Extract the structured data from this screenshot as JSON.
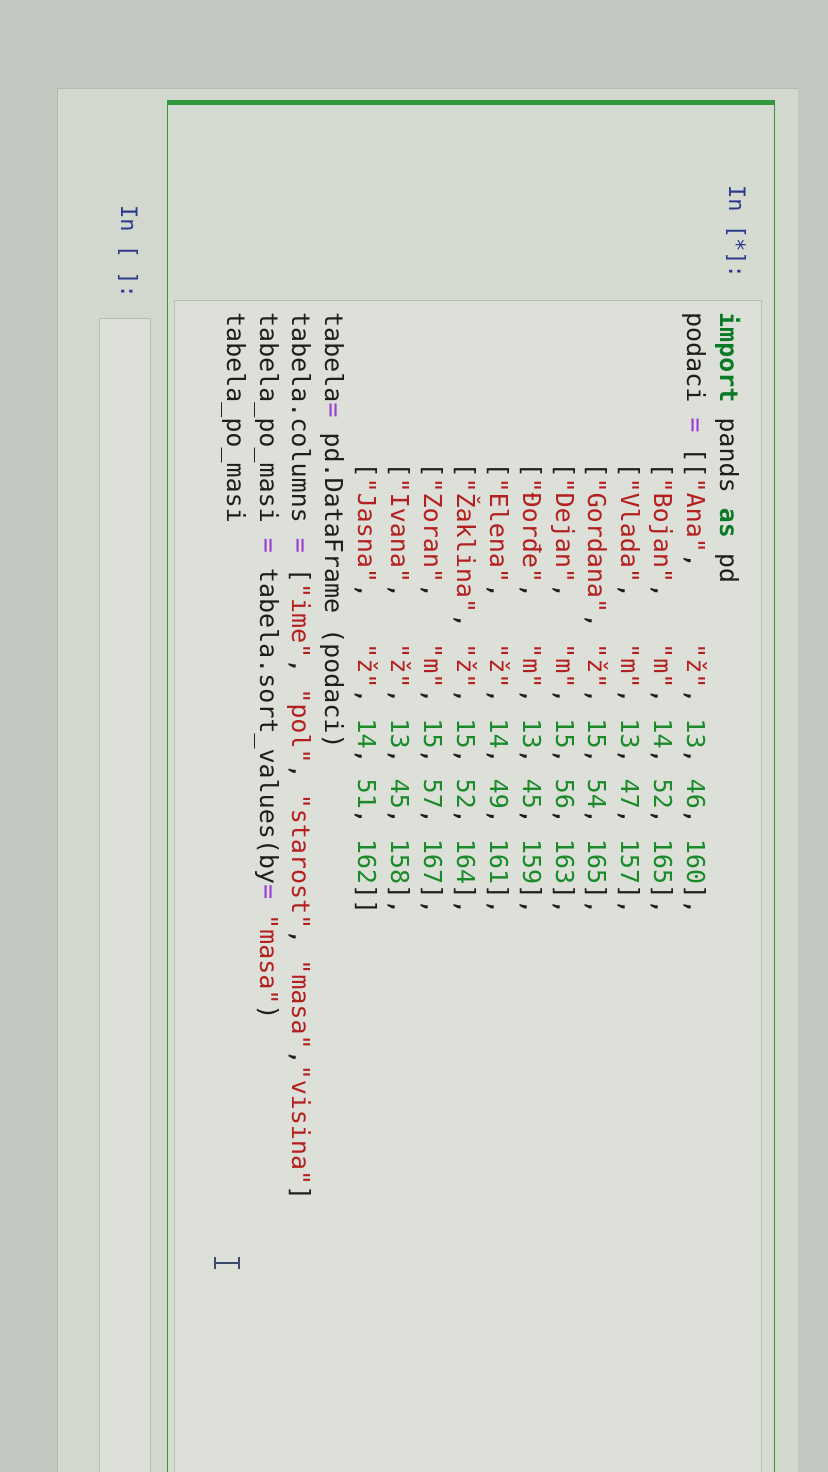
{
  "cells": [
    {
      "prompt": "In [*]:",
      "lines": [
        [
          [
            "import",
            "kw"
          ],
          [
            " pands ",
            "t"
          ],
          [
            "as",
            "kw"
          ],
          [
            " pd",
            "t"
          ]
        ],
        [
          [
            "podaci ",
            "t"
          ],
          [
            "=",
            "op"
          ],
          [
            " [[",
            "t"
          ],
          [
            "\"Ana\"",
            "st"
          ],
          [
            ",     ",
            "t"
          ],
          [
            "\"ž\"",
            "st"
          ],
          [
            ", ",
            "t"
          ],
          [
            "13",
            "nu"
          ],
          [
            ", ",
            "t"
          ],
          [
            "46",
            "nu"
          ],
          [
            ", ",
            "t"
          ],
          [
            "160",
            "nu"
          ],
          [
            "],",
            "t"
          ]
        ],
        [
          [
            "          [",
            "t"
          ],
          [
            "\"Bojan\"",
            "st"
          ],
          [
            ",   ",
            "t"
          ],
          [
            "\"m\"",
            "st"
          ],
          [
            ", ",
            "t"
          ],
          [
            "14",
            "nu"
          ],
          [
            ", ",
            "t"
          ],
          [
            "52",
            "nu"
          ],
          [
            ", ",
            "t"
          ],
          [
            "165",
            "nu"
          ],
          [
            "],",
            "t"
          ]
        ],
        [
          [
            "          [",
            "t"
          ],
          [
            "\"Vlada\"",
            "st"
          ],
          [
            ",   ",
            "t"
          ],
          [
            "\"m\"",
            "st"
          ],
          [
            ", ",
            "t"
          ],
          [
            "13",
            "nu"
          ],
          [
            ", ",
            "t"
          ],
          [
            "47",
            "nu"
          ],
          [
            ", ",
            "t"
          ],
          [
            "157",
            "nu"
          ],
          [
            "],",
            "t"
          ]
        ],
        [
          [
            "          [",
            "t"
          ],
          [
            "\"Gordana\"",
            "st"
          ],
          [
            ", ",
            "t"
          ],
          [
            "\"ž\"",
            "st"
          ],
          [
            ", ",
            "t"
          ],
          [
            "15",
            "nu"
          ],
          [
            ", ",
            "t"
          ],
          [
            "54",
            "nu"
          ],
          [
            ", ",
            "t"
          ],
          [
            "165",
            "nu"
          ],
          [
            "],",
            "t"
          ]
        ],
        [
          [
            "          [",
            "t"
          ],
          [
            "\"Dejan\"",
            "st"
          ],
          [
            ",   ",
            "t"
          ],
          [
            "\"m\"",
            "st"
          ],
          [
            ", ",
            "t"
          ],
          [
            "15",
            "nu"
          ],
          [
            ", ",
            "t"
          ],
          [
            "56",
            "nu"
          ],
          [
            ", ",
            "t"
          ],
          [
            "163",
            "nu"
          ],
          [
            "],",
            "t"
          ]
        ],
        [
          [
            "          [",
            "t"
          ],
          [
            "\"Đorđe\"",
            "st"
          ],
          [
            ",   ",
            "t"
          ],
          [
            "\"m\"",
            "st"
          ],
          [
            ", ",
            "t"
          ],
          [
            "13",
            "nu"
          ],
          [
            ", ",
            "t"
          ],
          [
            "45",
            "nu"
          ],
          [
            ", ",
            "t"
          ],
          [
            "159",
            "nu"
          ],
          [
            "],",
            "t"
          ]
        ],
        [
          [
            "          [",
            "t"
          ],
          [
            "\"Elena\"",
            "st"
          ],
          [
            ",   ",
            "t"
          ],
          [
            "\"ž\"",
            "st"
          ],
          [
            ", ",
            "t"
          ],
          [
            "14",
            "nu"
          ],
          [
            ", ",
            "t"
          ],
          [
            "49",
            "nu"
          ],
          [
            ", ",
            "t"
          ],
          [
            "161",
            "nu"
          ],
          [
            "],",
            "t"
          ]
        ],
        [
          [
            "          [",
            "t"
          ],
          [
            "\"Žaklina\"",
            "st"
          ],
          [
            ", ",
            "t"
          ],
          [
            "\"ž\"",
            "st"
          ],
          [
            ", ",
            "t"
          ],
          [
            "15",
            "nu"
          ],
          [
            ", ",
            "t"
          ],
          [
            "52",
            "nu"
          ],
          [
            ", ",
            "t"
          ],
          [
            "164",
            "nu"
          ],
          [
            "],",
            "t"
          ]
        ],
        [
          [
            "          [",
            "t"
          ],
          [
            "\"Zoran\"",
            "st"
          ],
          [
            ",   ",
            "t"
          ],
          [
            "\"m\"",
            "st"
          ],
          [
            ", ",
            "t"
          ],
          [
            "15",
            "nu"
          ],
          [
            ", ",
            "t"
          ],
          [
            "57",
            "nu"
          ],
          [
            ", ",
            "t"
          ],
          [
            "167",
            "nu"
          ],
          [
            "],",
            "t"
          ]
        ],
        [
          [
            "          [",
            "t"
          ],
          [
            "\"Ivana\"",
            "st"
          ],
          [
            ",   ",
            "t"
          ],
          [
            "\"ž\"",
            "st"
          ],
          [
            ", ",
            "t"
          ],
          [
            "13",
            "nu"
          ],
          [
            ", ",
            "t"
          ],
          [
            "45",
            "nu"
          ],
          [
            ", ",
            "t"
          ],
          [
            "158",
            "nu"
          ],
          [
            "],",
            "t"
          ]
        ],
        [
          [
            "          [",
            "t"
          ],
          [
            "\"Jasna\"",
            "st"
          ],
          [
            ",   ",
            "t"
          ],
          [
            "\"ž\"",
            "st"
          ],
          [
            ", ",
            "t"
          ],
          [
            "14",
            "nu"
          ],
          [
            ", ",
            "t"
          ],
          [
            "51",
            "nu"
          ],
          [
            ", ",
            "t"
          ],
          [
            "162",
            "nu"
          ],
          [
            "]]",
            "t"
          ]
        ],
        [
          [
            "tabela",
            "t"
          ],
          [
            "=",
            "op"
          ],
          [
            " pd.DataFrame (podaci)",
            "t"
          ]
        ],
        [
          [
            "tabela.columns ",
            "t"
          ],
          [
            "=",
            "op"
          ],
          [
            " [",
            "t"
          ],
          [
            "\"ime\"",
            "st"
          ],
          [
            ", ",
            "t"
          ],
          [
            "\"pol\"",
            "st"
          ],
          [
            ", ",
            "t"
          ],
          [
            "\"starost\"",
            "st"
          ],
          [
            ", ",
            "t"
          ],
          [
            "\"masa\"",
            "st"
          ],
          [
            ",",
            "t"
          ],
          [
            "\"visina\"",
            "st"
          ],
          [
            "]",
            "t"
          ]
        ],
        [
          [
            "tabela_po_masi ",
            "t"
          ],
          [
            "=",
            "op"
          ],
          [
            " tabela.sort_values(by",
            "t"
          ],
          [
            "=",
            "op"
          ],
          [
            " ",
            "t"
          ],
          [
            "\"masa\"",
            "st"
          ],
          [
            ")",
            "t"
          ]
        ],
        [
          [
            "tabela_po_masi",
            "t"
          ]
        ]
      ]
    },
    {
      "prompt": "In [ ]:"
    }
  ],
  "colors": {
    "selected_border": "#2e9a3c",
    "keyword": "#0b7a26",
    "string": "#b42020",
    "number": "#1b8a2a",
    "operator": "#9a3ad6",
    "prompt": "#2d3a8c"
  },
  "icons": {
    "cursor": "text-cursor-icon"
  }
}
